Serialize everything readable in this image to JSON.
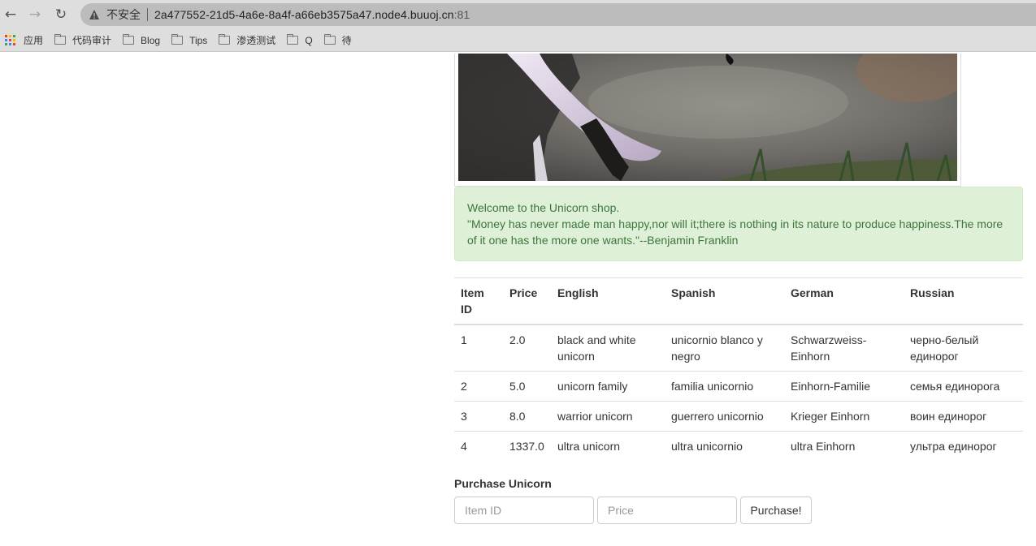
{
  "browser": {
    "security_label": "不安全",
    "url_host": "2a477552-21d5-4a6e-8a4f-a66eb3575a47.node4.buuoj.cn",
    "url_port": ":81",
    "bookmarks": [
      {
        "label": "应用",
        "icon": "apps-grid-icon"
      },
      {
        "label": "代码审计",
        "icon": "folder-icon"
      },
      {
        "label": "Blog",
        "icon": "folder-icon"
      },
      {
        "label": "Tips",
        "icon": "folder-icon"
      },
      {
        "label": "渗透测试",
        "icon": "folder-icon"
      },
      {
        "label": "Q",
        "icon": "folder-icon"
      },
      {
        "label": "待",
        "icon": "folder-icon"
      }
    ]
  },
  "alert": {
    "line1": "Welcome to the Unicorn shop.",
    "line2": "\"Money has never made man happy,nor will it;there is nothing in its nature to produce happiness.The more of it one has the more one wants.\"--Benjamin Franklin"
  },
  "table": {
    "headers": [
      "Item ID",
      "Price",
      "English",
      "Spanish",
      "German",
      "Russian"
    ],
    "rows": [
      [
        "1",
        "2.0",
        "black and white unicorn",
        "unicornio blanco y negro",
        "Schwarzweiss-Einhorn",
        "черно-белый единорог"
      ],
      [
        "2",
        "5.0",
        "unicorn family",
        "familia unicornio",
        "Einhorn-Familie",
        "семья единорога"
      ],
      [
        "3",
        "8.0",
        "warrior unicorn",
        "guerrero unicornio",
        "Krieger Einhorn",
        "воин единорог"
      ],
      [
        "4",
        "1337.0",
        "ultra unicorn",
        "ultra unicornio",
        "ultra Einhorn",
        "ультра единорог"
      ]
    ]
  },
  "purchase": {
    "title": "Purchase Unicorn",
    "item_id_placeholder": "Item ID",
    "price_placeholder": "Price",
    "button_label": "Purchase!"
  },
  "colors": {
    "alert_bg": "#dff0d8",
    "alert_text": "#3c763d",
    "chrome_bg": "#dedede"
  }
}
